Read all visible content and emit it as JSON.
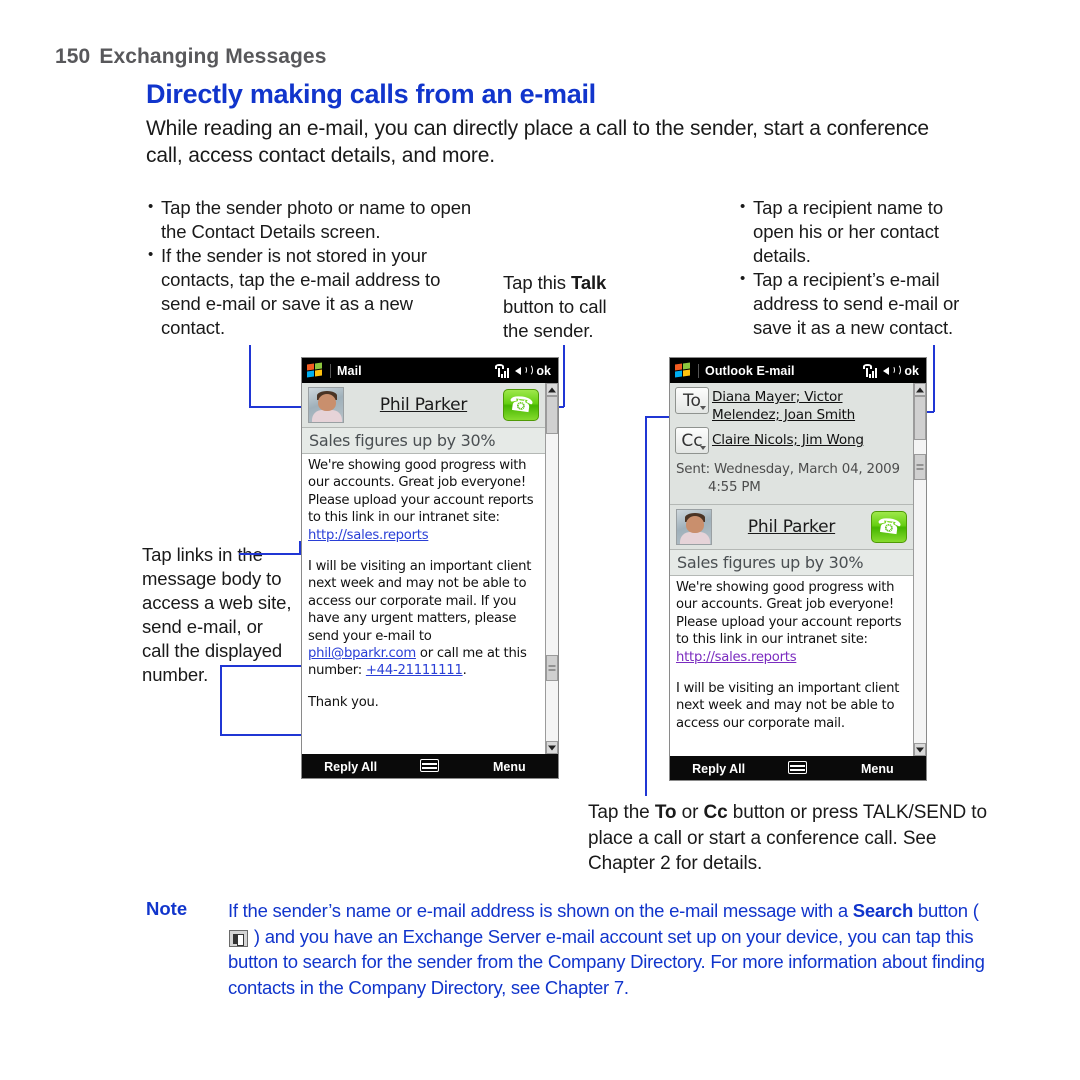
{
  "page": {
    "number": "150",
    "running_head": "Exchanging Messages",
    "title": "Directly making calls from an e-mail",
    "intro": "While reading an e-mail, you can directly place a call to the sender, start a conference call, access contact details, and more."
  },
  "callouts": {
    "left_top": {
      "bullet1": "Tap the sender photo or name to open the Contact Details screen.",
      "bullet2": "If the sender is not stored in your contacts, tap the e-mail address to send e-mail or save it as a new contact."
    },
    "talk": {
      "line1_prefix": "Tap this ",
      "line1_bold": "Talk",
      "line2": "button to call",
      "line3": "the sender."
    },
    "right_top": {
      "bullet1": "Tap a recipient name to open his or her contact details.",
      "bullet2": "Tap a recipient’s e-mail address to send e-mail or save it as a new contact."
    },
    "left_links": "Tap links in the message body to access a web site, send e-mail, or call the displayed number.",
    "bottom": {
      "seg1": "Tap the ",
      "bold1": "To",
      "seg2": " or ",
      "bold2": "Cc",
      "seg3": " button or press TALK/SEND to place a call or start a conference call. See Chapter 2 for details."
    }
  },
  "note": {
    "label": "Note",
    "seg1": "If the sender’s name or e-mail address is shown on the e-mail message with a ",
    "bold1": "Search",
    "seg2": " button ( ",
    "icon": "search-button-icon",
    "seg3": " ) and you have an Exchange Server e-mail account set up on your device, you can tap this button to search for the sender from the Company Directory. For more information about finding contacts in the Company Directory, see Chapter 7."
  },
  "device_left": {
    "titlebar": {
      "app": "Mail",
      "signal_icon": "signal-strength-icon",
      "speaker_icon": "speaker-icon",
      "ok_label": "ok"
    },
    "sender": {
      "photo_alt": "sender-photo",
      "name": "Phil Parker",
      "talk_button_icon": "phone-handset-icon"
    },
    "subject": "Sales figures up by 30%",
    "body": {
      "p1_a": "We're showing good progress with our accounts. Great job everyone! Please upload your account reports to this link in our intranet site: ",
      "p1_link": "http://sales.reports",
      "p2_a": "I will be visiting an important client next week and may not be able to access our corporate mail. If you have any urgent matters, please send your e-mail to ",
      "p2_link_mail": "phil@bparkr.com",
      "p2_b": " or call me at this number: ",
      "p2_link_tel": "+44-21111111",
      "p2_c": ".",
      "p3": "Thank you."
    },
    "softkeys": {
      "left": "Reply All",
      "center_icon": "keyboard-icon",
      "right": "Menu"
    }
  },
  "device_right": {
    "titlebar": {
      "app": "Outlook E-mail",
      "signal_icon": "signal-strength-icon",
      "speaker_icon": "speaker-icon",
      "ok_label": "ok"
    },
    "to_field": {
      "button_label": "To",
      "names": "Diana Mayer; Victor Melendez; Joan Smith"
    },
    "cc_field": {
      "button_label": "Cc",
      "names": "Claire Nicols; Jim Wong"
    },
    "sent": {
      "line1": "Sent: Wednesday, March 04, 2009",
      "line2": "4:55 PM"
    },
    "sender": {
      "photo_alt": "sender-photo",
      "name": "Phil Parker",
      "talk_button_icon": "phone-handset-icon"
    },
    "subject": "Sales figures up by 30%",
    "body": {
      "p1_a": "We're showing good progress with our accounts. Great job everyone! Please upload your account reports to this link in our intranet site: ",
      "p1_link": "http://sales.reports",
      "p2": "I will be visiting an important client next week and may not be able to access our corporate mail."
    },
    "softkeys": {
      "left": "Reply All",
      "center_icon": "keyboard-icon",
      "right": "Menu"
    }
  },
  "colors": {
    "heading_blue": "#1135cc",
    "connector_blue": "#2036d4",
    "running_head_gray": "#58585b",
    "talk_green": "#5cc40a"
  }
}
